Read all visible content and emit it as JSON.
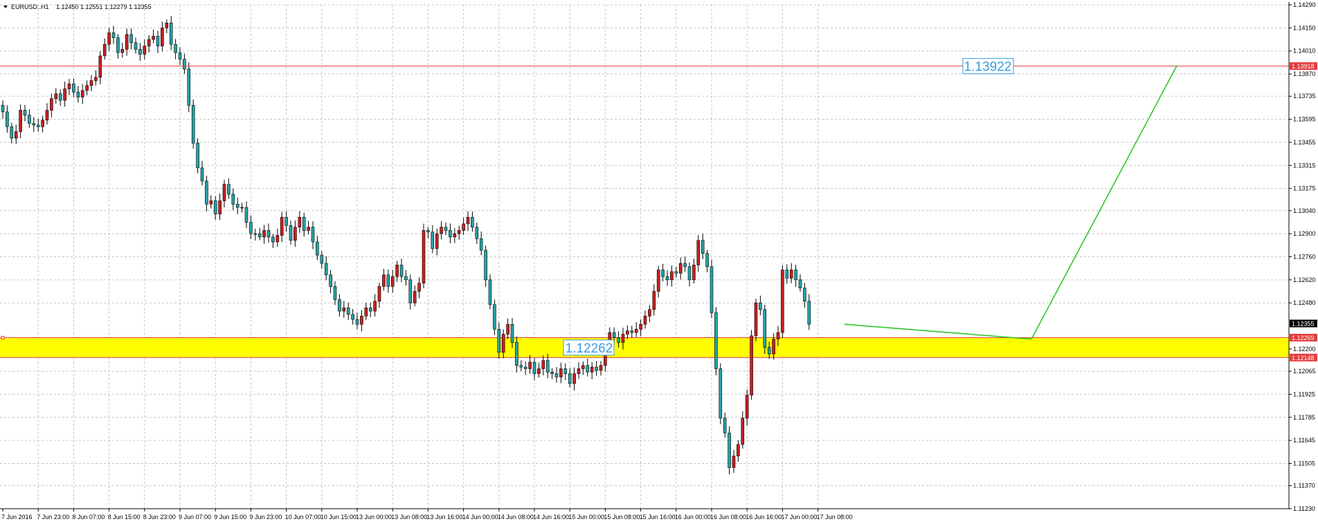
{
  "header": {
    "symbol": "EURUSD..H1",
    "ohlc": "1.12450 1.12551 1.12279 1.12355"
  },
  "colors": {
    "bull": "#cc1f1f",
    "bear": "#23a3a8",
    "zone_fill": "#ffff00",
    "level_line": "#e43c3c",
    "projection": "#22c422",
    "note_text": "#3a9be0",
    "price_tag": "#e43c3c",
    "current_tag": "#000000"
  },
  "chart_data": {
    "type": "candlestick",
    "title": "",
    "xlabel": "",
    "ylabel": "",
    "ylim": [
      1.1123,
      1.1429
    ],
    "grid": true,
    "y_ticks": [
      "1.14290",
      "1.14150",
      "1.14010",
      "1.13870",
      "1.13735",
      "1.13595",
      "1.13455",
      "1.13315",
      "1.13175",
      "1.13040",
      "1.12900",
      "1.12760",
      "1.12620",
      "1.12480",
      "1.12200",
      "1.12065",
      "1.11925",
      "1.11785",
      "1.11645",
      "1.11505",
      "1.11370",
      "1.11230"
    ],
    "x_ticks": [
      "7 Jun 2016",
      "7 Jun 23:00",
      "8 Jun 07:00",
      "8 Jun 15:00",
      "8 Jun 23:00",
      "9 Jun 07:00",
      "9 Jun 15:00",
      "9 Jun 23:00",
      "10 Jun 07:00",
      "10 Jun 15:00",
      "13 Jun 00:00",
      "13 Jun 08:00",
      "13 Jun 16:00",
      "14 Jun 00:00",
      "14 Jun 08:00",
      "14 Jun 16:00",
      "15 Jun 00:00",
      "15 Jun 08:00",
      "15 Jun 16:00",
      "16 Jun 00:00",
      "16 Jun 08:00",
      "16 Jun 16:00",
      "17 Jun 00:00",
      "17 Jun 08:00"
    ],
    "x_tick_index": [
      0,
      8,
      16,
      24,
      32,
      40,
      48,
      56,
      64,
      72,
      80,
      88,
      96,
      104,
      112,
      120,
      128,
      136,
      144,
      152,
      160,
      168,
      176,
      184
    ],
    "close_prices": [
      1.1364,
      1.1355,
      1.1348,
      1.1352,
      1.1365,
      1.1362,
      1.1357,
      1.1356,
      1.1355,
      1.1359,
      1.1365,
      1.1372,
      1.1375,
      1.1371,
      1.1378,
      1.1381,
      1.1376,
      1.1373,
      1.1377,
      1.138,
      1.1383,
      1.1385,
      1.1398,
      1.1405,
      1.1412,
      1.1409,
      1.14,
      1.1402,
      1.1411,
      1.1406,
      1.1402,
      1.1399,
      1.1404,
      1.1408,
      1.141,
      1.1404,
      1.1415,
      1.1418,
      1.1405,
      1.14,
      1.1396,
      1.139,
      1.1368,
      1.1345,
      1.133,
      1.1322,
      1.1308,
      1.131,
      1.1302,
      1.131,
      1.132,
      1.1314,
      1.1308,
      1.1306,
      1.1306,
      1.1297,
      1.129,
      1.129,
      1.1288,
      1.1292,
      1.1288,
      1.1285,
      1.1289,
      1.13,
      1.1295,
      1.1286,
      1.1294,
      1.13,
      1.1292,
      1.1294,
      1.1285,
      1.1277,
      1.1272,
      1.1265,
      1.1258,
      1.125,
      1.1243,
      1.1245,
      1.1241,
      1.1238,
      1.1235,
      1.124,
      1.1245,
      1.1243,
      1.1249,
      1.1258,
      1.1265,
      1.1258,
      1.1264,
      1.1271,
      1.1264,
      1.1262,
      1.1248,
      1.1255,
      1.126,
      1.1292,
      1.1291,
      1.1281,
      1.129,
      1.1294,
      1.1292,
      1.1288,
      1.129,
      1.1292,
      1.1296,
      1.13,
      1.1294,
      1.1287,
      1.128,
      1.1262,
      1.1247,
      1.1232,
      1.1218,
      1.1229,
      1.1235,
      1.1224,
      1.121,
      1.1209,
      1.1208,
      1.1212,
      1.1205,
      1.1208,
      1.1213,
      1.1206,
      1.1205,
      1.1203,
      1.1208,
      1.1205,
      1.1199,
      1.1205,
      1.1208,
      1.121,
      1.1206,
      1.1209,
      1.1207,
      1.121,
      1.1221,
      1.123,
      1.1227,
      1.1224,
      1.1229,
      1.1231,
      1.123,
      1.1232,
      1.1235,
      1.124,
      1.1244,
      1.1255,
      1.1268,
      1.1264,
      1.1262,
      1.1267,
      1.1266,
      1.1272,
      1.127,
      1.1262,
      1.1271,
      1.1286,
      1.1278,
      1.127,
      1.1242,
      1.1208,
      1.1178,
      1.1169,
      1.1148,
      1.1155,
      1.1162,
      1.1178,
      1.1192,
      1.1228,
      1.1248,
      1.1244,
      1.1221,
      1.1217,
      1.1226,
      1.123,
      1.1268,
      1.1263,
      1.1268,
      1.1262,
      1.1257,
      1.1249,
      1.1235
    ],
    "support_zone": {
      "high": 1.12269,
      "low": 1.12148,
      "label": "1.12262"
    },
    "resistance_line": {
      "value": 1.13918,
      "label": "1.13922"
    },
    "current_price": "1.12355",
    "price_tags": [
      "1.13918",
      "1.12269",
      "1.12148"
    ],
    "projection": {
      "from_index": 190,
      "path": [
        1.1235,
        1.1226,
        1.1392
      ]
    }
  }
}
